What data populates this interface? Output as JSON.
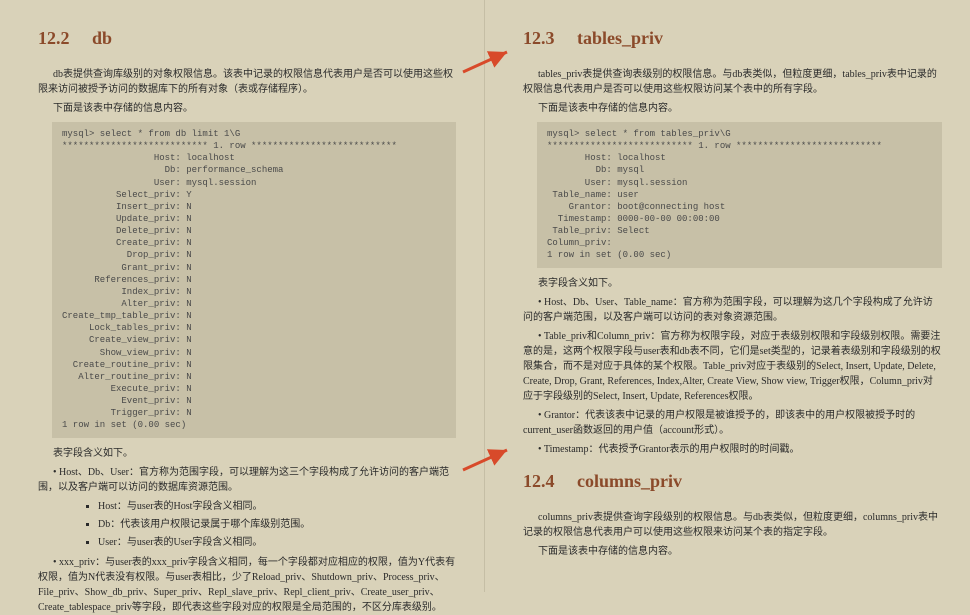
{
  "left": {
    "heading_num": "12.2",
    "heading_text": "db",
    "p1": "db表提供查询库级别的对象权限信息。该表中记录的权限信息代表用户是否可以使用这些权限来访问被授予访问的数据库下的所有对象（表或存储程序）。",
    "p2": "下面是该表中存储的信息内容。",
    "code": "mysql> select * from db limit 1\\G\n*************************** 1. row ***************************\n                 Host: localhost\n                   Db: performance_schema\n                 User: mysql.session\n          Select_priv: Y\n          Insert_priv: N\n          Update_priv: N\n          Delete_priv: N\n          Create_priv: N\n            Drop_priv: N\n           Grant_priv: N\n      References_priv: N\n           Index_priv: N\n           Alter_priv: N\nCreate_tmp_table_priv: N\n     Lock_tables_priv: N\n     Create_view_priv: N\n       Show_view_priv: N\n  Create_routine_priv: N\n   Alter_routine_priv: N\n         Execute_priv: N\n           Event_priv: N\n         Trigger_priv: N\n1 row in set (0.00 sec)",
    "p3": "表字段含义如下。",
    "p4": "• Host、Db、User：官方称为范围字段，可以理解为这三个字段构成了允许访问的客户端范围，以及客户端可以访问的数据库资源范围。",
    "b1": "Host：与user表的Host字段含义相同。",
    "b2": "Db：代表该用户权限记录属于哪个库级别范围。",
    "b3": "User：与user表的User字段含义相同。",
    "p5": "• xxx_priv：与user表的xxx_priv字段含义相同，每一个字段都对应相应的权限，值为Y代表有权限，值为N代表没有权限。与user表相比，少了Reload_priv、Shutdown_priv、Process_priv、File_priv、Show_db_priv、Super_priv、Repl_slave_priv、Repl_client_priv、Create_user_priv、Create_tablespace_priv等字段，即代表这些字段对应的权限是全局范围的，不区分库表级别。"
  },
  "right": {
    "heading1_num": "12.3",
    "heading1_text": "tables_priv",
    "p1": "tables_priv表提供查询表级别的权限信息。与db表类似，但粒度更细，tables_priv表中记录的权限信息代表用户是否可以使用这些权限访问某个表中的所有字段。",
    "p2": "下面是该表中存储的信息内容。",
    "code": "mysql> select * from tables_priv\\G\n*************************** 1. row ***************************\n       Host: localhost\n         Db: mysql\n       User: mysql.session\n Table_name: user\n    Grantor: boot@connecting host\n  Timestamp: 0000-00-00 00:00:00\n Table_priv: Select\nColumn_priv:\n1 row in set (0.00 sec)",
    "p3": "表字段含义如下。",
    "p4": "• Host、Db、User、Table_name：官方称为范围字段，可以理解为这几个字段构成了允许访问的客户端范围，以及客户端可以访问的表对象资源范围。",
    "p5": "• Table_priv和Column_priv：官方称为权限字段，对应于表级别权限和字段级别权限。需要注意的是，这两个权限字段与user表和db表不同，它们是set类型的，记录着表级别和字段级别的权限集合，而不是对应于具体的某个权限。Table_priv对应于表级别的Select, Insert, Update, Delete, Create, Drop, Grant, References, Index,Alter, Create View, Show view, Trigger权限，Column_priv对应于字段级别的Select, Insert, Update, References权限。",
    "p6": "• Grantor：代表该表中记录的用户权限是被谁授予的，即该表中的用户权限被授予时的current_user函数返回的用户值（account形式）。",
    "p7": "• Timestamp：代表授予Grantor表示的用户权限时的时间戳。",
    "heading2_num": "12.4",
    "heading2_text": "columns_priv",
    "p8": "columns_priv表提供查询字段级别的权限信息。与db表类似，但粒度更细，columns_priv表中记录的权限信息代表用户可以使用这些权限来访问某个表的指定字段。",
    "p9": "下面是该表中存储的信息内容。"
  }
}
